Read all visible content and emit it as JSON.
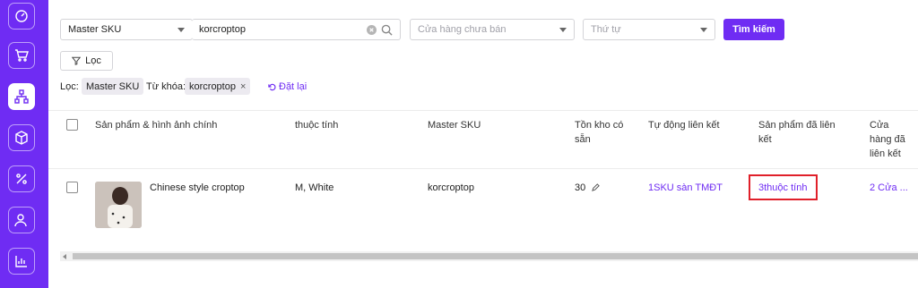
{
  "sidebar": {
    "items": [
      {
        "icon": "dashboard-icon"
      },
      {
        "icon": "cart-icon"
      },
      {
        "icon": "sitemap-icon",
        "active": true
      },
      {
        "icon": "box-icon"
      },
      {
        "icon": "percent-icon"
      },
      {
        "icon": "users-icon"
      },
      {
        "icon": "chart-icon"
      }
    ],
    "accent": "#6f2cf3"
  },
  "filters": {
    "search_field": "Master SKU",
    "keyword_value": "korcroptop",
    "store_placeholder": "Cửa hàng chưa bán",
    "sort_placeholder": "Thứ tự",
    "search_button": "Tìm kiếm",
    "filter_button": "Lọc"
  },
  "active_filters": {
    "label": "Lọc:",
    "chip_field": "Master SKU",
    "keyword_label": "Từ khóa:",
    "chip_keyword": "korcroptop",
    "reset": "Đặt lại"
  },
  "table": {
    "headers": {
      "product": "Sản phẩm & hình ảnh chính",
      "attribute": "thuộc tính",
      "master_sku": "Master SKU",
      "stock_line1": "Tồn kho có",
      "stock_line2": "sẵn",
      "auto_link": "Tự động liên kết",
      "linked_line1": "Sản phẩm đã liên",
      "linked_line2": "kết",
      "store_line1": "Cửa",
      "store_line2": "hàng đã",
      "store_line3": "liên kết"
    },
    "rows": [
      {
        "product_name": "Chinese style croptop",
        "attribute": "M, White",
        "master_sku": "korcroptop",
        "stock": "30",
        "auto_link": "1SKU sàn TMĐT",
        "linked_products": "3thuộc tính",
        "linked_stores": "2 Cửa ..."
      }
    ]
  }
}
